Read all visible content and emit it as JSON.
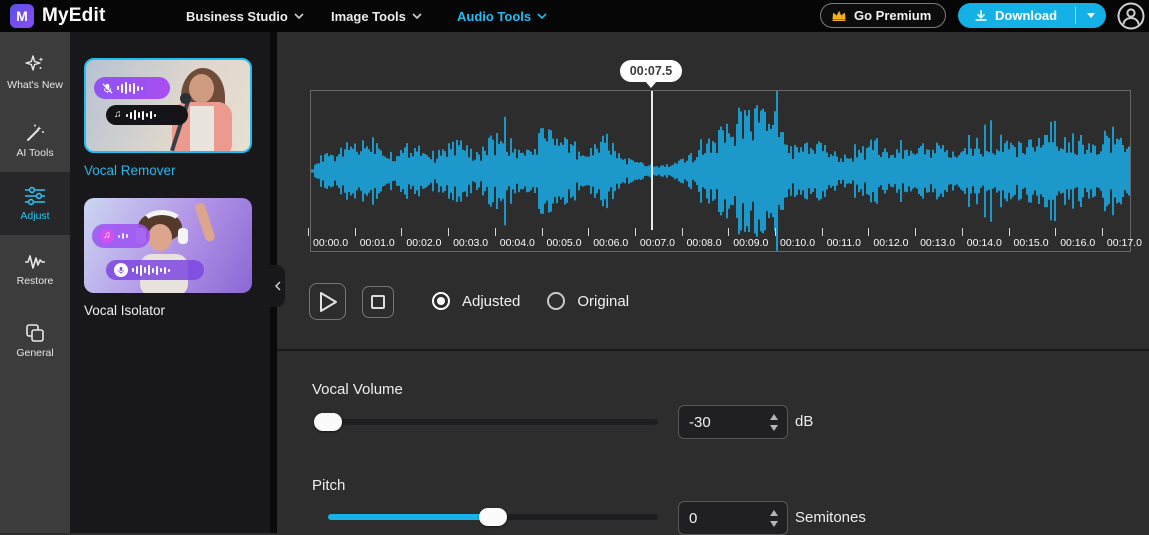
{
  "navbar": {
    "brand": "MyEdit",
    "menus": [
      {
        "label": "Business Studio"
      },
      {
        "label": "Image Tools"
      },
      {
        "label": "Audio Tools"
      }
    ],
    "go_premium": "Go Premium",
    "download": "Download"
  },
  "sidebar": {
    "items": [
      {
        "label": "What's New"
      },
      {
        "label": "AI Tools"
      },
      {
        "label": "Adjust"
      },
      {
        "label": "Restore"
      },
      {
        "label": "General"
      }
    ]
  },
  "tool_panel": {
    "tools": [
      {
        "label": "Vocal Remover",
        "selected": true
      },
      {
        "label": "Vocal Isolator",
        "selected": false
      }
    ]
  },
  "player": {
    "position_tooltip": "00:07.5",
    "timeline_labels": [
      "00:00.0",
      "00:01.0",
      "00:02.0",
      "00:03.0",
      "00:04.0",
      "00:05.0",
      "00:06.0",
      "00:07.0",
      "00:08.0",
      "00:09.0",
      "00:10.0",
      "00:11.0",
      "00:12.0",
      "00:13.0",
      "00:14.0",
      "00:15.0",
      "00:16.0",
      "00:17.0"
    ],
    "modes": [
      {
        "label": "Adjusted",
        "selected": true
      },
      {
        "label": "Original",
        "selected": false
      }
    ]
  },
  "controls": {
    "vocal_volume": {
      "label": "Vocal Volume",
      "value": "-30",
      "unit": "dB"
    },
    "pitch": {
      "label": "Pitch",
      "value": "0",
      "unit": "Semitones"
    }
  },
  "colors": {
    "accent_cyan": "#14b1e7",
    "waveform": "#1aa5dc",
    "crown_gold": "#f2b11c"
  }
}
